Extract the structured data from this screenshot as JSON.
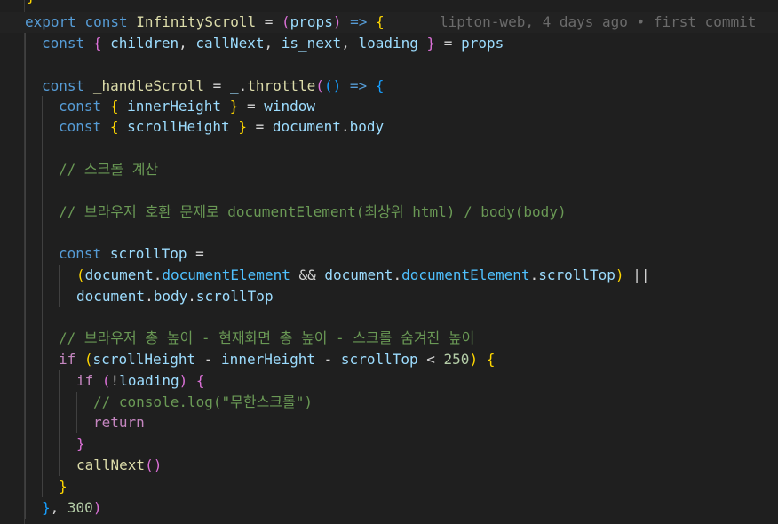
{
  "blame": {
    "line1": "lipton-web, 4 days ago • first commit"
  },
  "peek": {
    "top_char": "}"
  },
  "code": {
    "l1": {
      "export": "export",
      "const": "const",
      "name": "InfinityScroll",
      "eq": " = ",
      "open": "(",
      "props": "props",
      "close": ")",
      "arrow": " => ",
      "brace": "{"
    },
    "l2": {
      "const": "const",
      "open": "{",
      "children": "children",
      "c1": ", ",
      "callNext": "callNext",
      "c2": ", ",
      "is_next": "is_next",
      "c3": ", ",
      "loading": "loading",
      "close": "}",
      "eq": " = ",
      "props": "props"
    },
    "l4": {
      "const": "const",
      "name": "_handleScroll",
      "eq": " = ",
      "underscore": "_",
      "dot": ".",
      "throttle": "throttle",
      "p1": "(",
      "p2": "()",
      "arrow": " => ",
      "brace": "{"
    },
    "l5": {
      "const": "const",
      "open": "{",
      "innerHeight": "innerHeight",
      "close": "}",
      "eq": " = ",
      "window": "window"
    },
    "l6": {
      "const": "const",
      "open": "{",
      "scrollHeight": "scrollHeight",
      "close": "}",
      "eq": " = ",
      "document": "document",
      "dot": ".",
      "body": "body"
    },
    "l8": {
      "comment": "// 스크롤 계산"
    },
    "l10": {
      "comment": "// 브라우저 호환 문제로 documentElement(최상위 html) / body(body)"
    },
    "l12": {
      "const": "const",
      "scrollTop": "scrollTop",
      "eq": " ="
    },
    "l13": {
      "open": "(",
      "document": "document",
      "dot1": ".",
      "documentElement": "documentElement",
      "and": " && ",
      "document2": "document",
      "dot2": ".",
      "documentElement2": "documentElement",
      "dot3": ".",
      "scrollTop": "scrollTop",
      "close": ")",
      "or": " ||"
    },
    "l14": {
      "document": "document",
      "dot1": ".",
      "body": "body",
      "dot2": ".",
      "scrollTop": "scrollTop"
    },
    "l16": {
      "comment": "// 브라우저 총 높이 - 현재화면 총 높이 - 스크롤 숨겨진 높이"
    },
    "l17": {
      "if": "if",
      "open": "(",
      "scrollHeight": "scrollHeight",
      "minus1": " - ",
      "innerHeight": "innerHeight",
      "minus2": " - ",
      "scrollTop": "scrollTop",
      "lt": " < ",
      "num": "250",
      "close": ")",
      "brace": "{"
    },
    "l18": {
      "if": "if",
      "open": "(",
      "not": "!",
      "loading": "loading",
      "close": ")",
      "brace": "{"
    },
    "l19": {
      "comment": "// console.log(\"무한스크롤\")"
    },
    "l20": {
      "return": "return"
    },
    "l21": {
      "brace": "}"
    },
    "l22": {
      "callNext": "callNext",
      "parens": "()"
    },
    "l23": {
      "brace": "}"
    },
    "l24": {
      "brace": "}",
      "comma": ", ",
      "num": "300",
      "close": ")"
    }
  }
}
